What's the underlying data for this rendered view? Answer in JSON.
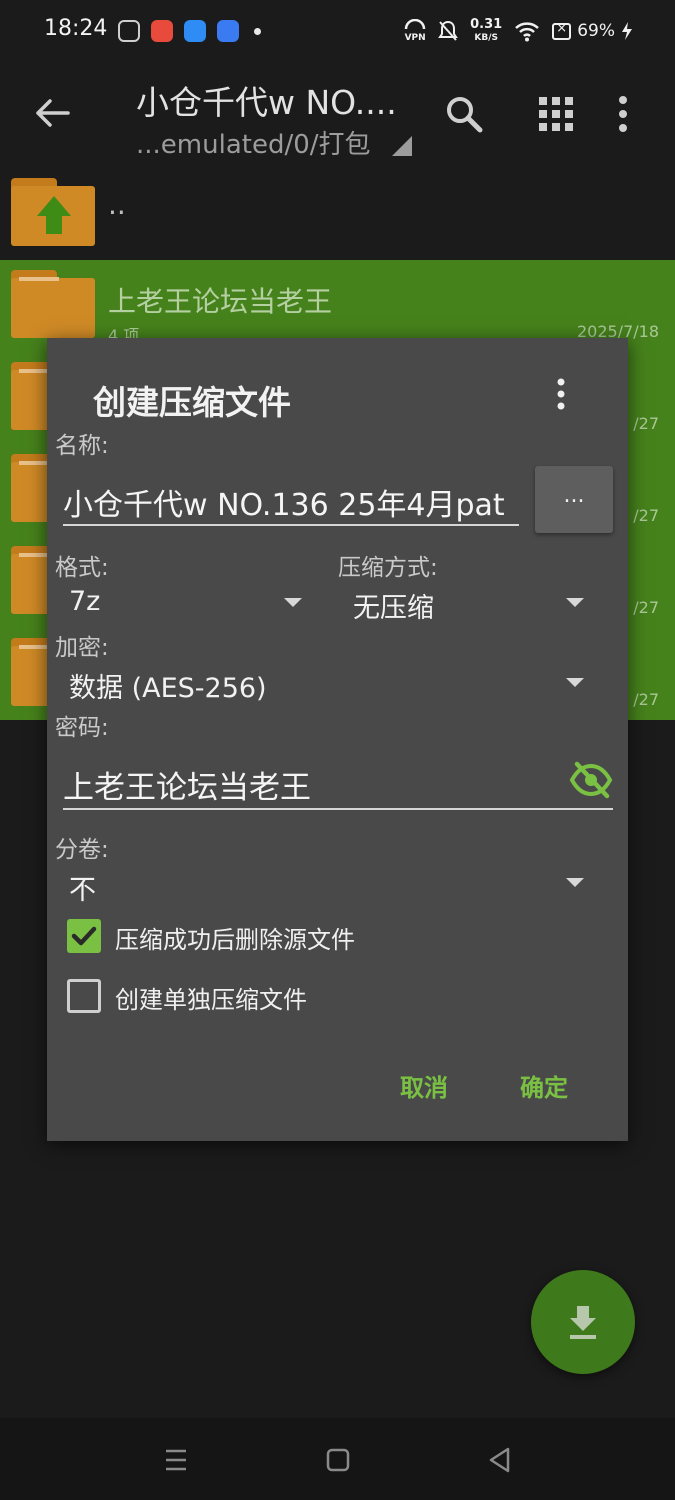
{
  "status_bar": {
    "time": "18:24",
    "vpn_label": "VPN",
    "speed_value": "0.31",
    "speed_unit": "KB/S",
    "battery": "69%"
  },
  "app_bar": {
    "title": "小仓千代w NO....",
    "path": "...emulated/0/打包"
  },
  "file_list": {
    "parent_label": "..",
    "rows": [
      {
        "name": "上老王论坛当老王",
        "meta": "4 项",
        "date": "2025/7/18"
      },
      {
        "date": "/27"
      },
      {
        "date": "/27"
      },
      {
        "date": "/27"
      },
      {
        "date": "/27"
      }
    ]
  },
  "dialog": {
    "title": "创建压缩文件",
    "name_label": "名称:",
    "name_value": "小仓千代w NO.136 25年4月pat",
    "browse_label": "...",
    "format_label": "格式:",
    "format_value": "7z",
    "method_label": "压缩方式:",
    "method_value": "无压缩",
    "encrypt_label": "加密:",
    "encrypt_value": "数据 (AES-256)",
    "password_label": "密码:",
    "password_value": "上老王论坛当老王",
    "split_label": "分卷:",
    "split_value": "不",
    "delete_source_label": "压缩成功后删除源文件",
    "delete_source_checked": true,
    "separate_label": "创建单独压缩文件",
    "separate_checked": false,
    "cancel_label": "取消",
    "ok_label": "确定"
  },
  "colors": {
    "accent": "#7ac143",
    "selection": "#46821c",
    "dialog_bg": "#494949",
    "folder": "#cf8a26"
  }
}
